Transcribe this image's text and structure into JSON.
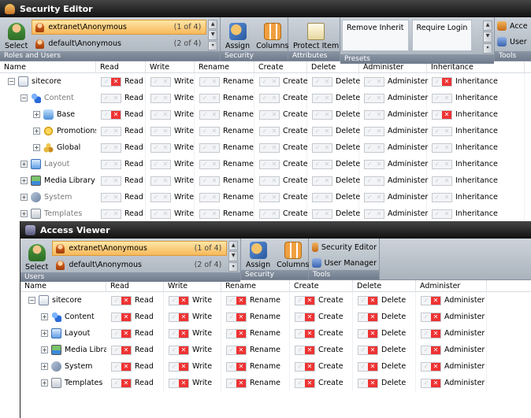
{
  "security_editor": {
    "title": "Security Editor",
    "ribbon": {
      "select_label": "Select",
      "users": [
        {
          "name": "extranet\\Anonymous",
          "count": "(1 of 4)",
          "selected": true
        },
        {
          "name": "default\\Anonymous",
          "count": "(2 of 4)",
          "selected": false
        }
      ],
      "group_roles": "Roles and Users",
      "assign_label": "Assign",
      "columns_label": "Columns",
      "group_security": "Security",
      "protect_label": "Protect Item",
      "group_attributes": "Attributes",
      "presets": [
        "Remove Inherit",
        "Require Login"
      ],
      "group_presets": "Presets",
      "tools": [
        "Acce",
        "User"
      ],
      "group_tools": "Tools"
    },
    "columns": [
      "Name",
      "Read",
      "Write",
      "Rename",
      "Create",
      "Delete",
      "Administer",
      "Inheritance"
    ],
    "rows": [
      {
        "name": "sitecore",
        "icon": "doc",
        "level": 0,
        "exp": "-",
        "dim": false,
        "deny": [
          true,
          false,
          false,
          false,
          false,
          false,
          true
        ]
      },
      {
        "name": "Content",
        "icon": "content",
        "level": 1,
        "exp": "-",
        "dim": true,
        "deny": [
          false,
          false,
          false,
          false,
          false,
          false,
          false
        ]
      },
      {
        "name": "Base",
        "icon": "base",
        "level": 2,
        "exp": "+",
        "dim": false,
        "deny": [
          true,
          false,
          false,
          false,
          false,
          false,
          true
        ]
      },
      {
        "name": "Promotions",
        "icon": "promo",
        "level": 2,
        "exp": "+",
        "dim": false,
        "deny": [
          false,
          false,
          false,
          false,
          false,
          false,
          false
        ]
      },
      {
        "name": "Global",
        "icon": "global",
        "level": 2,
        "exp": "+",
        "dim": false,
        "deny": [
          false,
          false,
          false,
          false,
          false,
          false,
          false
        ]
      },
      {
        "name": "Layout",
        "icon": "layout",
        "level": 1,
        "exp": "+",
        "dim": true,
        "deny": [
          false,
          false,
          false,
          false,
          false,
          false,
          false
        ]
      },
      {
        "name": "Media Library",
        "icon": "media",
        "level": 1,
        "exp": "+",
        "dim": false,
        "deny": [
          false,
          false,
          false,
          false,
          false,
          false,
          false
        ]
      },
      {
        "name": "System",
        "icon": "system",
        "level": 1,
        "exp": "+",
        "dim": true,
        "deny": [
          false,
          false,
          false,
          false,
          false,
          false,
          false
        ]
      },
      {
        "name": "Templates",
        "icon": "templates",
        "level": 1,
        "exp": "+",
        "dim": true,
        "deny": [
          false,
          false,
          false,
          false,
          false,
          false,
          false
        ]
      }
    ]
  },
  "access_viewer": {
    "title": "Access Viewer",
    "ribbon": {
      "select_label": "Select",
      "users": [
        {
          "name": "extranet\\Anonymous",
          "count": "(1 of 4)",
          "selected": true
        },
        {
          "name": "default\\Anonymous",
          "count": "(2 of 4)",
          "selected": false
        }
      ],
      "group_users": "Users",
      "assign_label": "Assign",
      "columns_label": "Columns",
      "group_security": "Security",
      "tools": [
        "Security Editor",
        "User Manager"
      ],
      "group_tools": "Tools"
    },
    "columns": [
      "Name",
      "Read",
      "Write",
      "Rename",
      "Create",
      "Delete",
      "Administer"
    ],
    "rows": [
      {
        "name": "sitecore",
        "icon": "doc",
        "level": 0,
        "exp": "-"
      },
      {
        "name": "Content",
        "icon": "content",
        "level": 1,
        "exp": "+"
      },
      {
        "name": "Layout",
        "icon": "layout",
        "level": 1,
        "exp": "+"
      },
      {
        "name": "Media Library",
        "icon": "media",
        "level": 1,
        "exp": "+"
      },
      {
        "name": "System",
        "icon": "system",
        "level": 1,
        "exp": "+"
      },
      {
        "name": "Templates",
        "icon": "templates",
        "level": 1,
        "exp": "+"
      }
    ]
  },
  "check_marks": {
    "allow": "✓",
    "deny": "✕"
  }
}
